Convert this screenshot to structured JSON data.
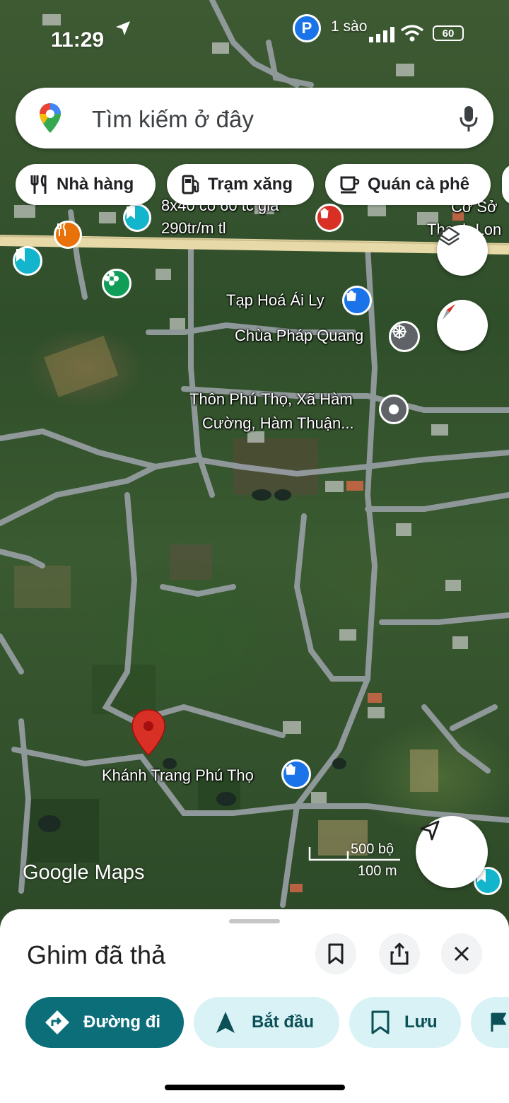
{
  "status_bar": {
    "time": "11:29",
    "parking_label": "P",
    "parking_text": "1 sào",
    "battery_level": "60"
  },
  "search": {
    "placeholder": "Tìm kiếm ở đây"
  },
  "chips": [
    {
      "label": "Nhà hàng",
      "icon": "restaurant-icon"
    },
    {
      "label": "Trạm xăng",
      "icon": "gas-station-icon"
    },
    {
      "label": "Quán cà phê",
      "icon": "coffee-icon"
    }
  ],
  "map": {
    "labels": {
      "listing_line1": "8x40 có 60 tc giá",
      "listing_line2": "290tr/m tl",
      "right_top_line1": "Cơ Sở",
      "right_top_line2": "Thanh Lon",
      "grocery": "Tạp Hoá Ái Ly",
      "pagoda": "Chùa Pháp Quang",
      "village_line1": "Thôn Phú Thọ, Xã Hàm",
      "village_line2": "Cường, Hàm Thuận...",
      "shop": "Khánh Trang Phú Thọ"
    },
    "scale": {
      "imperial": "500 bộ",
      "metric": "100 m"
    },
    "logo": "Google Maps",
    "colors": {
      "road_main": "#e8d9a8",
      "road": "#9aa0a6",
      "pin": "#d93025",
      "poi_blue": "#1a73e8",
      "poi_teal": "#12b5cb",
      "poi_orange": "#e8710a",
      "poi_green": "#0f9d58",
      "poi_red": "#d93025"
    }
  },
  "sheet": {
    "title": "Ghim đã thả",
    "actions": [
      {
        "label": "Đường đi"
      },
      {
        "label": "Bắt đầu"
      },
      {
        "label": "Lưu"
      }
    ],
    "colors": {
      "primary": "#0b6e79",
      "secondary_bg": "#d8f2f5",
      "secondary_text": "#0b4f57"
    }
  }
}
